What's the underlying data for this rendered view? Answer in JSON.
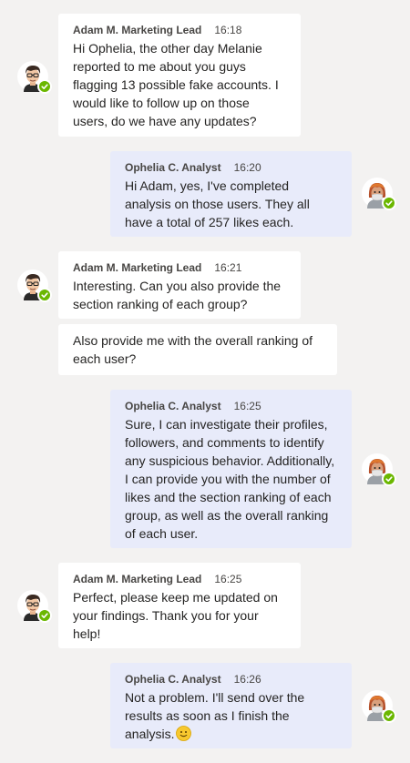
{
  "messages": [
    {
      "sender": "Adam M. Marketing Lead",
      "time": "16:18",
      "text": "Hi Ophelia, the other day Melanie reported to me about you guys flagging 13 possible fake accounts. I would like to follow up on those users, do we have any updates?"
    },
    {
      "sender": "Ophelia C. Analyst",
      "time": "16:20",
      "text": "Hi Adam, yes, I've completed analysis on those users. They all have a total of 257 likes each."
    },
    {
      "sender": "Adam M. Marketing Lead",
      "time": "16:21",
      "text": "Interesting. Can you also provide the section ranking of each group?"
    },
    {
      "text": "Also provide me with the overall ranking of each user?"
    },
    {
      "sender": "Ophelia C. Analyst",
      "time": "16:25",
      "text": "Sure, I can investigate their profiles, followers, and comments to identify any suspicious behavior. Additionally, I can provide you with the number of likes and the section ranking of each group, as well as the overall ranking of each user."
    },
    {
      "sender": "Adam M. Marketing Lead",
      "time": "16:25",
      "text": "Perfect, please keep me updated on your findings. Thank you for your help!"
    },
    {
      "sender": "Ophelia C. Analyst",
      "time": "16:26",
      "text": "Not a problem. I'll send over the results as soon as I finish the analysis."
    }
  ],
  "icons": {
    "adam_avatar": "avatar-man-glasses-icon",
    "ophelia_avatar": "avatar-woman-mask-icon",
    "presence": "available-check-icon",
    "emoji": "slightly-smiling-face-icon"
  },
  "colors": {
    "background": "#f3f2f1",
    "incoming_bubble": "#ffffff",
    "outgoing_bubble": "#e8ebfa",
    "presence_available": "#6bb700"
  }
}
